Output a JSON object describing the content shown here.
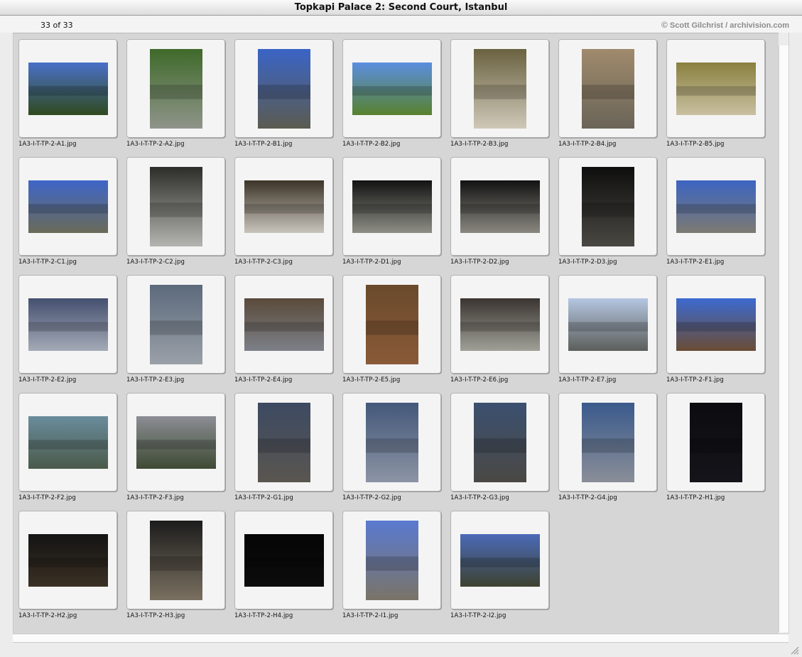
{
  "window": {
    "title": "Topkapi Palace 2: Second Court, Istanbul"
  },
  "header": {
    "count": "33 of 33",
    "credit_symbol": "©",
    "credit": "Scott Gilchrist / archivision.com"
  },
  "colors": {
    "panel": "#d6d6d6",
    "slide": "#f4f4f4",
    "credit_text": "#8c8c8c"
  },
  "slides": [
    {
      "file": "1A3-I-T-TP-2-A1.jpg",
      "orientation": "landscape",
      "top": "#4a70c8",
      "bottom": "#2f4a1e"
    },
    {
      "file": "1A3-I-T-TP-2-A2.jpg",
      "orientation": "portrait",
      "top": "#3f6a2a",
      "bottom": "#8f948a"
    },
    {
      "file": "1A3-I-T-TP-2-B1.jpg",
      "orientation": "portrait",
      "top": "#3a64c6",
      "bottom": "#5b5b50"
    },
    {
      "file": "1A3-I-T-TP-2-B2.jpg",
      "orientation": "landscape",
      "top": "#5b8ee0",
      "bottom": "#58822e"
    },
    {
      "file": "1A3-I-T-TP-2-B3.jpg",
      "orientation": "portrait",
      "top": "#6a6240",
      "bottom": "#cfc8b8"
    },
    {
      "file": "1A3-I-T-TP-2-B4.jpg",
      "orientation": "portrait",
      "top": "#a08a6c",
      "bottom": "#6a6458"
    },
    {
      "file": "1A3-I-T-TP-2-B5.jpg",
      "orientation": "landscape",
      "top": "#8a8040",
      "bottom": "#c8c0a0"
    },
    {
      "file": "1A3-I-T-TP-2-C1.jpg",
      "orientation": "landscape",
      "top": "#3e66c8",
      "bottom": "#6a6a58"
    },
    {
      "file": "1A3-I-T-TP-2-C2.jpg",
      "orientation": "portrait",
      "top": "#2c2c28",
      "bottom": "#b4b4b0"
    },
    {
      "file": "1A3-I-T-TP-2-C3.jpg",
      "orientation": "landscape",
      "top": "#3c3428",
      "bottom": "#c8c4bc"
    },
    {
      "file": "1A3-I-T-TP-2-D1.jpg",
      "orientation": "landscape",
      "top": "#121212",
      "bottom": "#8e8e86"
    },
    {
      "file": "1A3-I-T-TP-2-D2.jpg",
      "orientation": "landscape",
      "top": "#121212",
      "bottom": "#8a8880"
    },
    {
      "file": "1A3-I-T-TP-2-D3.jpg",
      "orientation": "portrait",
      "top": "#0e0e0e",
      "bottom": "#4a4842"
    },
    {
      "file": "1A3-I-T-TP-2-E1.jpg",
      "orientation": "landscape",
      "top": "#3c64c2",
      "bottom": "#7c7a72"
    },
    {
      "file": "1A3-I-T-TP-2-E2.jpg",
      "orientation": "landscape",
      "top": "#445070",
      "bottom": "#a4aab6"
    },
    {
      "file": "1A3-I-T-TP-2-E3.jpg",
      "orientation": "portrait",
      "top": "#5c6a7c",
      "bottom": "#9aa0a8"
    },
    {
      "file": "1A3-I-T-TP-2-E4.jpg",
      "orientation": "landscape",
      "top": "#5a4a3a",
      "bottom": "#7c8088"
    },
    {
      "file": "1A3-I-T-TP-2-E5.jpg",
      "orientation": "portrait",
      "top": "#6a4a2c",
      "bottom": "#8a5a38"
    },
    {
      "file": "1A3-I-T-TP-2-E6.jpg",
      "orientation": "landscape",
      "top": "#3a3430",
      "bottom": "#a0a098"
    },
    {
      "file": "1A3-I-T-TP-2-E7.jpg",
      "orientation": "landscape",
      "top": "#b4c6e2",
      "bottom": "#5c5e5a"
    },
    {
      "file": "1A3-I-T-TP-2-F1.jpg",
      "orientation": "landscape",
      "top": "#3c6ad0",
      "bottom": "#6a4c34"
    },
    {
      "file": "1A3-I-T-TP-2-F2.jpg",
      "orientation": "landscape",
      "top": "#6a8c9c",
      "bottom": "#4a5a4a"
    },
    {
      "file": "1A3-I-T-TP-2-F3.jpg",
      "orientation": "landscape",
      "top": "#8c8e94",
      "bottom": "#3e4a34"
    },
    {
      "file": "1A3-I-T-TP-2-G1.jpg",
      "orientation": "portrait",
      "top": "#3c4a62",
      "bottom": "#5a5650"
    },
    {
      "file": "1A3-I-T-TP-2-G2.jpg",
      "orientation": "portrait",
      "top": "#44587a",
      "bottom": "#8c94a4"
    },
    {
      "file": "1A3-I-T-TP-2-G3.jpg",
      "orientation": "portrait",
      "top": "#3c5070",
      "bottom": "#4a4844"
    },
    {
      "file": "1A3-I-T-TP-2-G4.jpg",
      "orientation": "portrait",
      "top": "#3a5a8c",
      "bottom": "#8a8e98"
    },
    {
      "file": "1A3-I-T-TP-2-H1.jpg",
      "orientation": "portrait",
      "top": "#0c0c10",
      "bottom": "#14141a"
    },
    {
      "file": "1A3-I-T-TP-2-H2.jpg",
      "orientation": "landscape",
      "top": "#141414",
      "bottom": "#3a3024"
    },
    {
      "file": "1A3-I-T-TP-2-H3.jpg",
      "orientation": "portrait",
      "top": "#1c1c1c",
      "bottom": "#7a7060"
    },
    {
      "file": "1A3-I-T-TP-2-H4.jpg",
      "orientation": "landscape",
      "top": "#050505",
      "bottom": "#0c0c0c"
    },
    {
      "file": "1A3-I-T-TP-2-I1.jpg",
      "orientation": "portrait",
      "top": "#5a7ad0",
      "bottom": "#7a7468"
    },
    {
      "file": "1A3-I-T-TP-2-I2.jpg",
      "orientation": "landscape",
      "top": "#4a6ab8",
      "bottom": "#3e4230"
    }
  ]
}
